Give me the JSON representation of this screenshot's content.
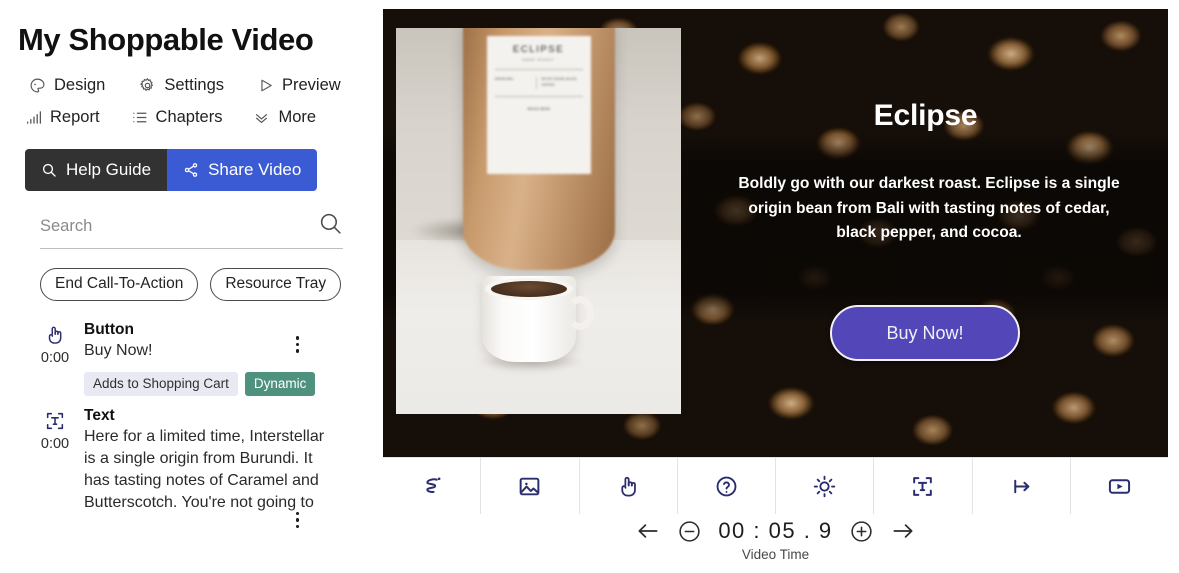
{
  "header": {
    "title": "My Shoppable Video"
  },
  "nav": {
    "row1": [
      {
        "label": "Design",
        "icon": "palette-icon"
      },
      {
        "label": "Settings",
        "icon": "gear-icon"
      },
      {
        "label": "Preview",
        "icon": "play-triangle-icon"
      }
    ],
    "row2": [
      {
        "label": "Report",
        "icon": "bar-chart-icon"
      },
      {
        "label": "Chapters",
        "icon": "list-icon"
      },
      {
        "label": "More",
        "icon": "chevron-double-down-icon"
      }
    ]
  },
  "actions": {
    "help_label": "Help Guide",
    "help_icon": "search-icon",
    "help_bg": "#323232",
    "share_label": "Share Video",
    "share_icon": "share-nodes-icon",
    "share_bg": "#3b5bd4"
  },
  "search": {
    "placeholder": "Search",
    "value": "",
    "icon": "search-icon"
  },
  "chips": [
    {
      "label": "End Call-To-Action"
    },
    {
      "label": "Resource Tray"
    }
  ],
  "elements": [
    {
      "icon": "pointing-hand-icon",
      "time": "0:00",
      "kind": "Button",
      "desc": "Buy Now!",
      "badges": [
        {
          "label": "Adds to Shopping Cart",
          "color": "#e8e9f2"
        },
        {
          "label": "Dynamic",
          "color": "#4e917f"
        }
      ]
    },
    {
      "icon": "text-box-icon",
      "time": "0:00",
      "kind": "Text",
      "desc": "Here for a limited time, Interstellar is a single origin from Burundi. It has tasting notes of Caramel and Butterscotch. You're not going to",
      "badges": []
    }
  ],
  "video": {
    "overlay_title": "Eclipse",
    "overlay_desc": "Boldly go with our darkest roast. Eclipse is a single origin bean from Bali with tasting notes of cedar, black pepper, and cocoa.",
    "cta_label": "Buy Now!",
    "cta_color": "#5246b8",
    "product_label": {
      "title": "ECLIPSE",
      "subtitle": "DARK ROAST",
      "col_left": "ORIGIN   BALI",
      "col_right": "NOTES   CEDAR, BLACK PEPPER",
      "footer": "WHOLE BEAN"
    }
  },
  "toolbar": [
    {
      "name": "draw-icon",
      "title": "Draw"
    },
    {
      "name": "image-icon",
      "title": "Image"
    },
    {
      "name": "hand-icon",
      "title": "Button"
    },
    {
      "name": "question-icon",
      "title": "Question"
    },
    {
      "name": "brightness-icon",
      "title": "Effects"
    },
    {
      "name": "text-box-icon",
      "title": "Text"
    },
    {
      "name": "jump-icon",
      "title": "Jump"
    },
    {
      "name": "video-icon",
      "title": "Video"
    }
  ],
  "time": {
    "prev_icon": "arrow-left-icon",
    "minus_icon": "minus-circle-icon",
    "value": "00 : 05 . 9",
    "plus_icon": "plus-circle-icon",
    "next_icon": "arrow-right-icon",
    "label": "Video Time"
  }
}
